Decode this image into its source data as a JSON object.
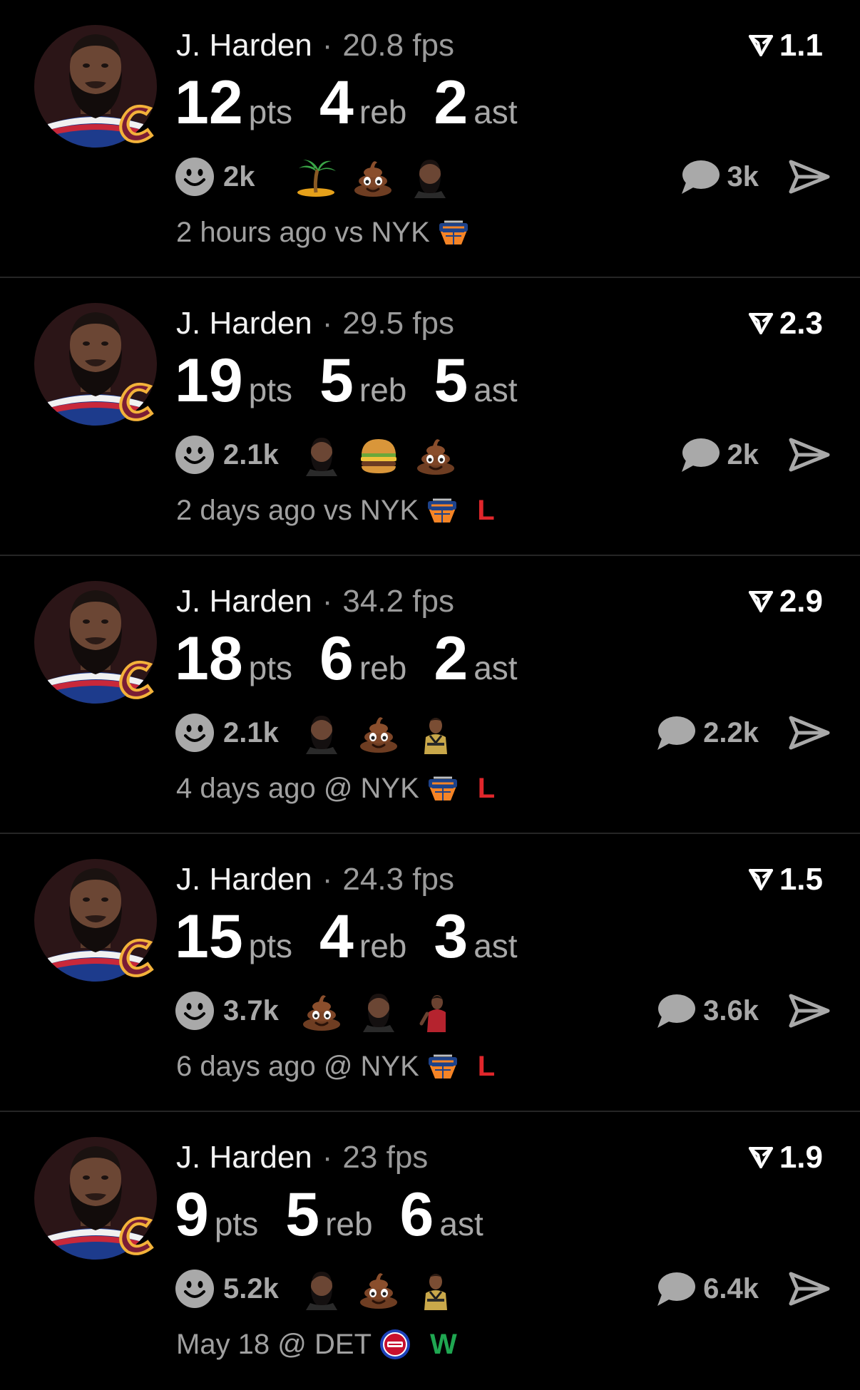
{
  "colors": {
    "background": "#000000",
    "divider": "#262626",
    "loss": "#e0262b",
    "win": "#1fa751",
    "muted": "#a8a8a8"
  },
  "icons": {
    "rating": "arrow-fork-icon",
    "reaction": "smiley-icon",
    "comments": "speech-bubble-icon",
    "share": "send-icon"
  },
  "posts": [
    {
      "player": "J. Harden",
      "separator": "·",
      "fps": "20.8 fps",
      "rating": "1.1",
      "stats": [
        {
          "value": "12",
          "unit": "pts"
        },
        {
          "value": "4",
          "unit": "reb"
        },
        {
          "value": "2",
          "unit": "ast"
        }
      ],
      "reactions_count": "2k",
      "emojis": [
        "island-emoji",
        "poop-emoji",
        "harden-sticker"
      ],
      "comments": "3k",
      "game_time": "2 hours ago",
      "location": "vs NYK",
      "opponent_logo": "knicks-logo",
      "result": ""
    },
    {
      "player": "J. Harden",
      "separator": "·",
      "fps": "29.5 fps",
      "rating": "2.3",
      "stats": [
        {
          "value": "19",
          "unit": "pts"
        },
        {
          "value": "5",
          "unit": "reb"
        },
        {
          "value": "5",
          "unit": "ast"
        }
      ],
      "reactions_count": "2.1k",
      "emojis": [
        "harden-sticker",
        "burger-emoji",
        "poop-emoji"
      ],
      "comments": "2k",
      "game_time": "2 days ago",
      "location": "vs NYK",
      "opponent_logo": "knicks-logo",
      "result": "L"
    },
    {
      "player": "J. Harden",
      "separator": "·",
      "fps": "34.2 fps",
      "rating": "2.9",
      "stats": [
        {
          "value": "18",
          "unit": "pts"
        },
        {
          "value": "6",
          "unit": "reb"
        },
        {
          "value": "2",
          "unit": "ast"
        }
      ],
      "reactions_count": "2.1k",
      "emojis": [
        "harden-sticker",
        "poop-emoji",
        "player-sticker"
      ],
      "comments": "2.2k",
      "game_time": "4 days ago",
      "location": "@ NYK",
      "opponent_logo": "knicks-logo",
      "result": "L"
    },
    {
      "player": "J. Harden",
      "separator": "·",
      "fps": "24.3 fps",
      "rating": "1.5",
      "stats": [
        {
          "value": "15",
          "unit": "pts"
        },
        {
          "value": "4",
          "unit": "reb"
        },
        {
          "value": "3",
          "unit": "ast"
        }
      ],
      "reactions_count": "3.7k",
      "emojis": [
        "poop-emoji",
        "harden-sticker",
        "player-red-sticker"
      ],
      "comments": "3.6k",
      "game_time": "6 days ago",
      "location": "@ NYK",
      "opponent_logo": "knicks-logo",
      "result": "L"
    },
    {
      "player": "J. Harden",
      "separator": "·",
      "fps": "23 fps",
      "rating": "1.9",
      "stats": [
        {
          "value": "9",
          "unit": "pts"
        },
        {
          "value": "5",
          "unit": "reb"
        },
        {
          "value": "6",
          "unit": "ast"
        }
      ],
      "reactions_count": "5.2k",
      "emojis": [
        "harden-sticker",
        "poop-emoji",
        "player-sticker"
      ],
      "comments": "6.4k",
      "game_time": "May 18",
      "location": "@ DET",
      "opponent_logo": "pistons-logo",
      "result": "W"
    }
  ]
}
